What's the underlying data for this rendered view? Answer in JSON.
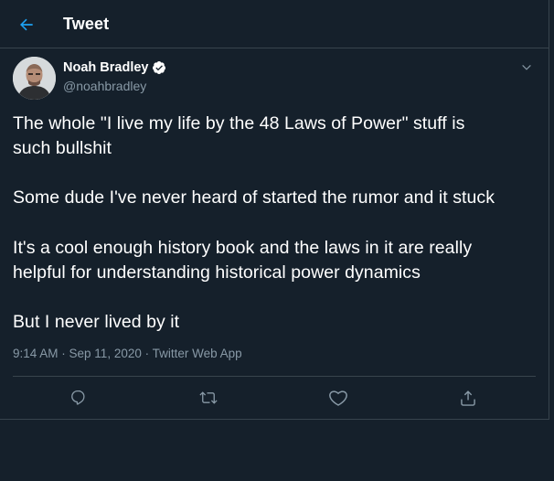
{
  "header": {
    "title": "Tweet",
    "back_icon": "arrow-left-icon"
  },
  "tweet": {
    "author": {
      "name": "Noah Bradley",
      "handle": "@noahbradley",
      "verified": true
    },
    "text_lines": [
      "The whole \"I live my life by the 48 Laws of Power\" stuff is",
      "such bullshit",
      "Some dude I've never heard of started the rumor and it stuck",
      "It's a cool enough history book and the laws in it are really",
      "helpful for understanding historical power dynamics",
      "But I never lived by it"
    ],
    "meta": {
      "time": "9:14 AM",
      "separator": " · ",
      "date": "Sep 11, 2020",
      "source": "Twitter Web App"
    }
  },
  "actions": [
    "reply-icon",
    "retweet-icon",
    "like-icon",
    "share-icon"
  ],
  "colors": {
    "background": "#15202b",
    "border": "#38444d",
    "accent": "#1da1f2",
    "secondary_text": "#8899a6"
  }
}
